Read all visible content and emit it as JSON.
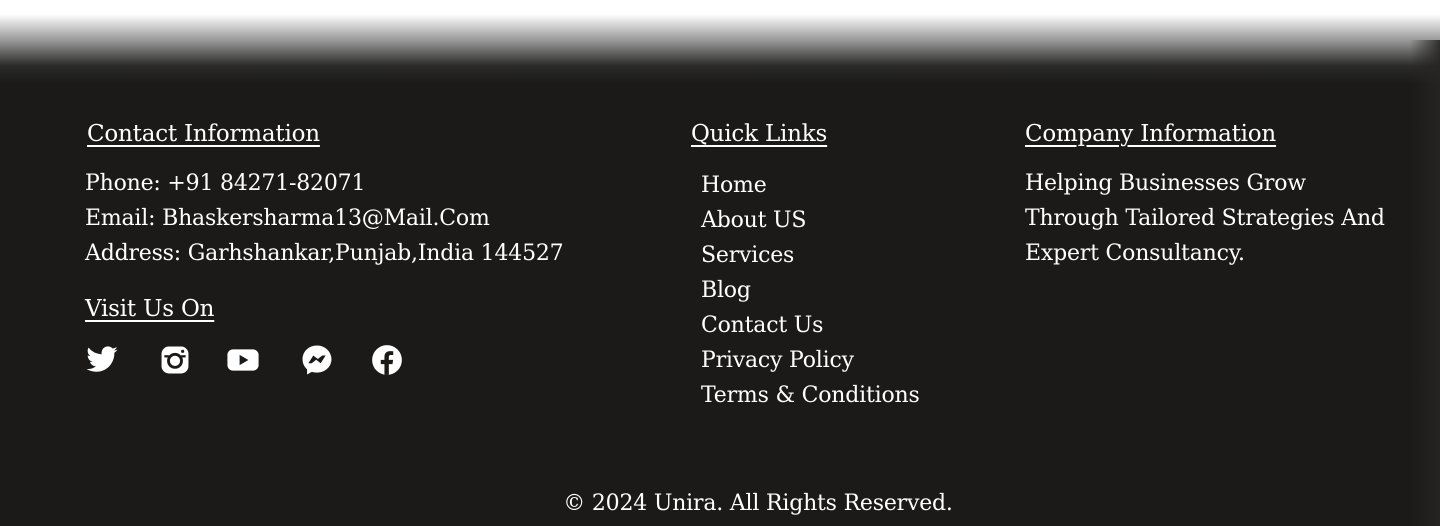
{
  "contact": {
    "heading": "Contact  Information",
    "phone": "Phone: +91 84271-82071",
    "email": "Email: Bhaskersharma13@Mail.Com",
    "address": "Address: Garhshankar,Punjab,India 144527"
  },
  "visit": {
    "heading": "Visit Us On",
    "icons": [
      "twitter-icon",
      "instagram-icon",
      "youtube-icon",
      "messenger-icon",
      "facebook-icon"
    ]
  },
  "quick_links": {
    "heading": "Quick Links",
    "items": [
      {
        "label": "Home"
      },
      {
        "label": "About US"
      },
      {
        "label": "Services"
      },
      {
        "label": "Blog"
      },
      {
        "label": "Contact Us"
      },
      {
        "label": "Privacy Policy"
      },
      {
        "label": "Terms & Conditions"
      }
    ]
  },
  "company": {
    "heading": "Company Information",
    "description": "Helping Businesses Grow Through Tailored Strategies And Expert Consultancy."
  },
  "copyright": "© 2024 Unira. All Rights Reserved.",
  "colors": {
    "footer_background": "#1b1a18",
    "text": "#ffffff"
  }
}
